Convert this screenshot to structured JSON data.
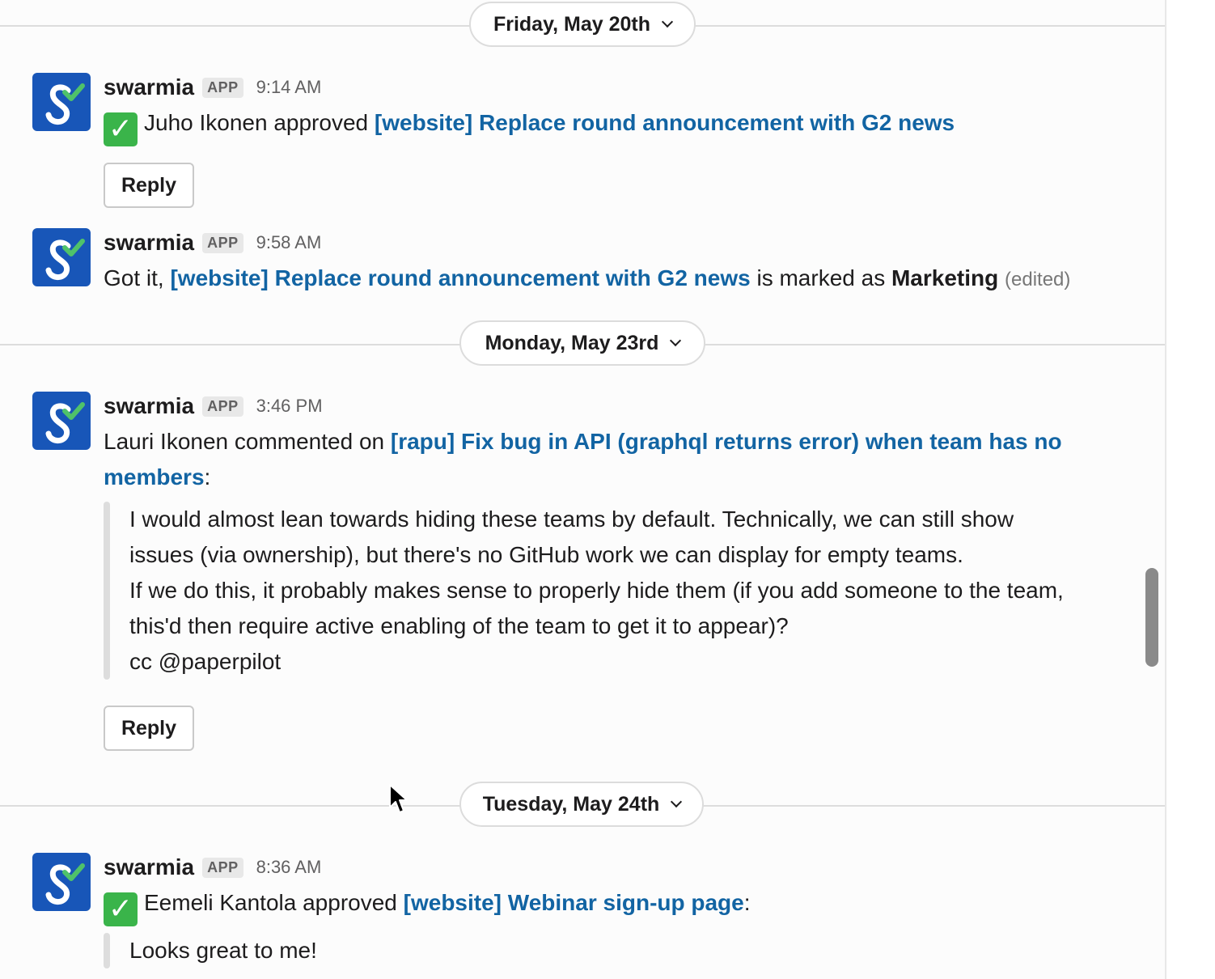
{
  "dates": {
    "d1": "Friday, May 20th",
    "d2": "Monday, May 23rd",
    "d3": "Tuesday, May 24th"
  },
  "app_name": "swarmia",
  "app_badge": "APP",
  "reply_label": "Reply",
  "msg1": {
    "time": "9:14 AM",
    "check": "✓",
    "actor": "Juho Ikonen approved ",
    "link": "[website] Replace round announcement with G2 news"
  },
  "msg2": {
    "time": "9:58 AM",
    "pre": "Got it, ",
    "link": "[website] Replace round announcement with G2 news",
    "mid": " is marked as ",
    "category": "Marketing",
    "edited": "(edited)"
  },
  "msg3": {
    "time": "3:46 PM",
    "actor": "Lauri Ikonen commented on ",
    "link": "[rapu] Fix bug in API (graphql returns error) when team has no members",
    "colon": ":",
    "quote": [
      "I would almost lean towards hiding these teams by default. Technically, we can still show issues (via ownership), but there's no GitHub work we can display for empty teams.",
      "If we do this, it probably makes sense to properly hide them (if you add someone to the team, this'd then require active enabling of the team to get it to appear)?",
      "cc @paperpilot"
    ]
  },
  "msg4": {
    "time": "8:36 AM",
    "check": "✓",
    "actor": "Eemeli Kantola approved ",
    "link": "[website] Webinar sign-up page",
    "colon": ":",
    "quote": "Looks great to me!"
  },
  "colors": {
    "link": "#1264a3",
    "avatar": "#1856b8",
    "check": "#3ab44a"
  }
}
